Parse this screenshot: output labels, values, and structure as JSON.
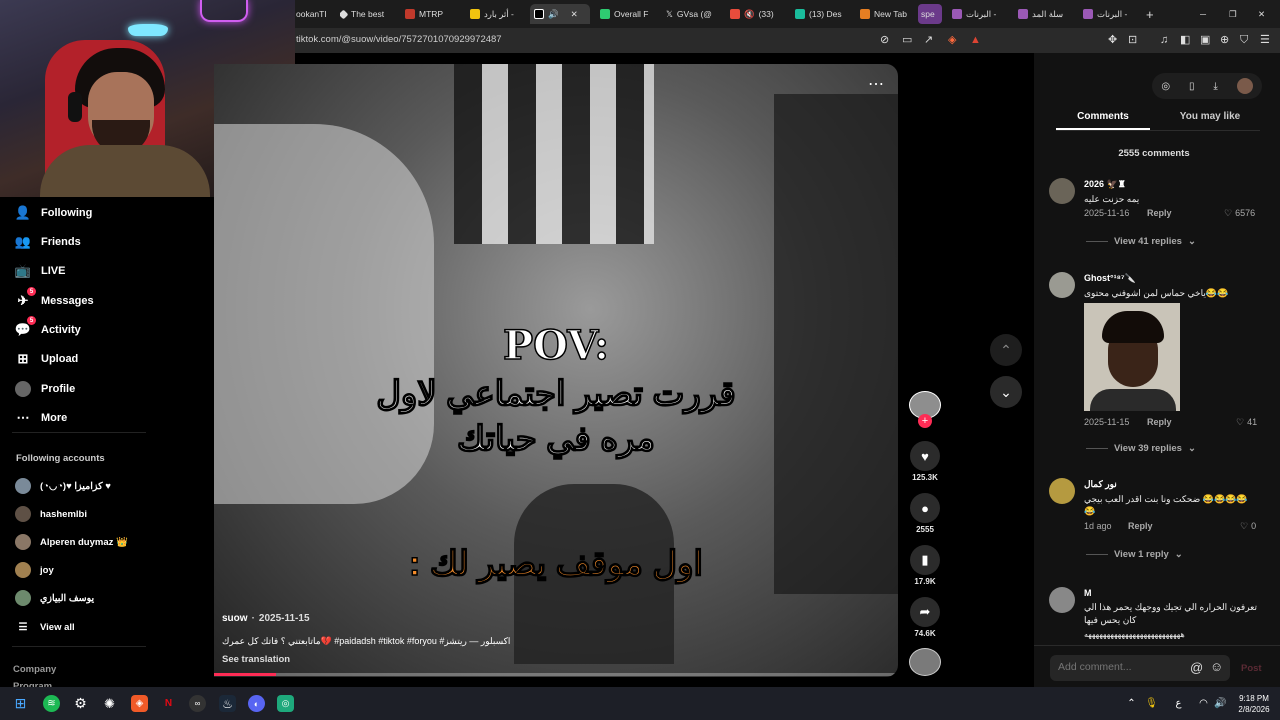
{
  "browser": {
    "tabs": [
      {
        "label": "ookanTI",
        "color": "#444444"
      },
      {
        "label": "The best",
        "color": "#dddddd"
      },
      {
        "label": "MTRP",
        "color": "#c0392b"
      },
      {
        "label": "أثر بارد -",
        "color": "#f1c40f"
      },
      {
        "label": "",
        "color": "#ffffff"
      },
      {
        "label": "Overall F",
        "color": "#2ecc71"
      },
      {
        "label": "GVsa (@",
        "color": "#ffffff"
      },
      {
        "label": "(33)",
        "color": "#e74c3c"
      },
      {
        "label": "(13) Des",
        "color": "#1abc9c"
      },
      {
        "label": "New Tab",
        "color": "#e67e22"
      },
      {
        "label": "spe",
        "color": "#8e44ad"
      },
      {
        "label": "البرنات -",
        "color": "#9b59b6"
      },
      {
        "label": "سلة المد",
        "color": "#9b59b6"
      },
      {
        "label": "البرنات -",
        "color": "#9b59b6"
      }
    ],
    "new_tab": "+",
    "url": "tiktok.com/@suow/video/7572701070929972487"
  },
  "sidebar": {
    "nav": [
      {
        "label": "Following",
        "icon": "people-icon",
        "glyph": "👤"
      },
      {
        "label": "Friends",
        "icon": "friends-icon",
        "glyph": "👥"
      },
      {
        "label": "LIVE",
        "icon": "live-icon",
        "glyph": "📺"
      },
      {
        "label": "Messages",
        "icon": "paper-plane-icon",
        "glyph": "✈",
        "badge": "5"
      },
      {
        "label": "Activity",
        "icon": "chat-bubble-icon",
        "glyph": "💬",
        "badge": "5"
      },
      {
        "label": "Upload",
        "icon": "plus-square-icon",
        "glyph": "⊞"
      },
      {
        "label": "Profile",
        "icon": "avatar-icon",
        "glyph": "●"
      },
      {
        "label": "More",
        "icon": "more-icon",
        "glyph": "⋯"
      }
    ],
    "following_heading": "Following accounts",
    "accounts": [
      {
        "name": "(◔◡◔)♥ كزاميزا ♥",
        "color": "#7a8a99"
      },
      {
        "name": "hashemlbi",
        "color": "#5e5045"
      },
      {
        "name": "Alperen duymaz 👑",
        "color": "#8a7766"
      },
      {
        "name": "joy",
        "color": "#a08050"
      },
      {
        "name": "يوسف البيازي",
        "color": "#6d8a6d"
      }
    ],
    "view_all": "View all",
    "footer": [
      "Company",
      "Program"
    ]
  },
  "video": {
    "pov": "POV:",
    "line1": "قررت تصير اجتماعي لاول",
    "line2": "مره في حياتك",
    "line3": "اول موقف يصير لك :",
    "author": "suow",
    "date": "2025-11-15",
    "caption": "ماتابعتني ؟ فاتك كل عمرك💔 #paidadsh #tiktok #foryou #اكسبلور — ريتشز",
    "see_translation": "See translation",
    "more": "⋯",
    "progress": 0.09
  },
  "actions": {
    "likes": "125.3K",
    "comments": "2555",
    "saves": "17.9K",
    "shares": "74.6K"
  },
  "panel": {
    "tabs": [
      "Comments",
      "You may like"
    ],
    "count_label": "2555 comments",
    "comments": [
      {
        "name": "2026 🦅♜",
        "text": "يمه حزنت عليه",
        "date": "2025-11-16",
        "reply": "Reply",
        "likes": "6576",
        "replies": "View 41 replies",
        "avatar": "#6a6458"
      },
      {
        "name": "Ghost°¹⁸⁷🔪",
        "text": "😂😂ياخي حماس لمن اشوفني محتوى",
        "date": "2025-11-15",
        "reply": "Reply",
        "likes": "41",
        "replies": "View 39 replies",
        "avatar": "#9a9a92"
      },
      {
        "name": "نور كمال",
        "text": "😂😂😂😂 ضحكت ونا بنت اقدر العب بيجي 😂",
        "date": "1d ago",
        "reply": "Reply",
        "likes": "0",
        "replies": "View 1 reply",
        "avatar": "#b59a40"
      },
      {
        "name": "M",
        "text": "تعرفون الحراره الي تجيك ووجهك يحمر هذا الي كان يحس فيها",
        "extra": "ههههههههههههههههههههههههههه",
        "avatar": "#888888"
      }
    ],
    "add_placeholder": "Add comment...",
    "post": "Post"
  },
  "taskbar": {
    "time": "9:18 PM",
    "date": "2/8/2026",
    "lang": "ع"
  }
}
